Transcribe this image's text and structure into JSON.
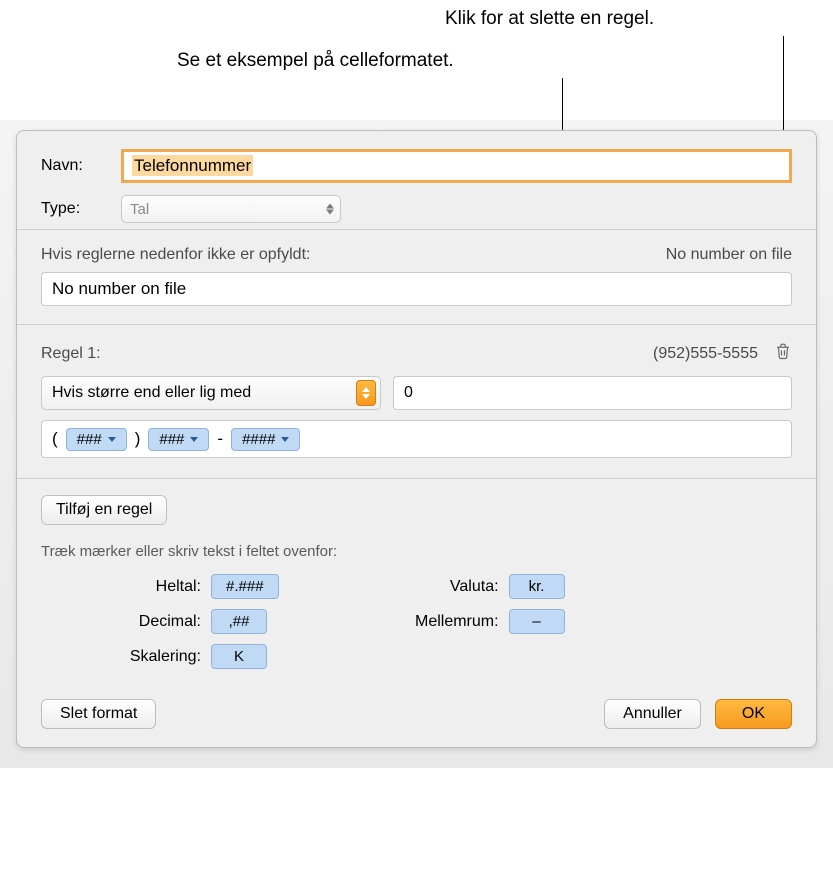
{
  "callouts": {
    "delete_rule": "Klik for at slette en regel.",
    "preview_format": "Se et eksempel på celleformatet."
  },
  "labels": {
    "name": "Navn:",
    "type": "Type:"
  },
  "name_value": "Telefonnummer",
  "type_value": "Tal",
  "fallback": {
    "label": "Hvis reglerne nedenfor ikke er opfyldt:",
    "preview": "No number on file",
    "value": "No number on file"
  },
  "rule1": {
    "label": "Regel 1:",
    "preview": "(952)555-5555",
    "condition": "Hvis større end eller lig med",
    "condition_value": "0",
    "format_tokens": {
      "t1": "###",
      "t2": "###",
      "t3": "####"
    },
    "format_literals": {
      "open_paren": "(",
      "close_paren": ")",
      "dash": "-"
    }
  },
  "add_rule_label": "Tilføj en regel",
  "helper": "Træk mærker eller skriv tekst i feltet ovenfor:",
  "tokens": {
    "integer_label": "Heltal:",
    "integer": "#.###",
    "decimal_label": "Decimal:",
    "decimal": ",##",
    "scale_label": "Skalering:",
    "scale": "K",
    "currency_label": "Valuta:",
    "currency": "kr.",
    "space_label": "Mellemrum:",
    "space": "–"
  },
  "footer": {
    "delete_format": "Slet format",
    "cancel": "Annuller",
    "ok": "OK"
  }
}
